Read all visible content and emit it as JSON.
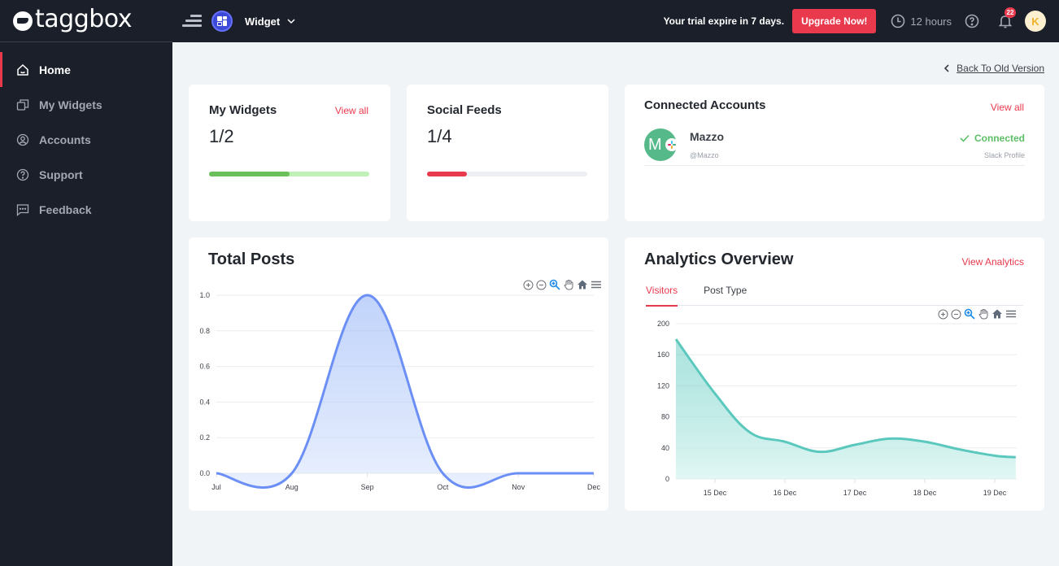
{
  "brand": {
    "name": "taggbox"
  },
  "sidebar": {
    "items": [
      {
        "label": "Home",
        "icon": "home-icon",
        "active": true
      },
      {
        "label": "My Widgets",
        "icon": "widgets-icon",
        "active": false
      },
      {
        "label": "Accounts",
        "icon": "user-circle-icon",
        "active": false
      },
      {
        "label": "Support",
        "icon": "question-circle-icon",
        "active": false
      },
      {
        "label": "Feedback",
        "icon": "chat-icon",
        "active": false
      }
    ]
  },
  "topbar": {
    "widget_label": "Widget",
    "trial_text": "Your trial expire in 7 days.",
    "upgrade_label": "Upgrade Now!",
    "hours_text": "12 hours",
    "notification_count": "22",
    "user_initial": "K"
  },
  "main": {
    "back_link": "Back To Old Version",
    "my_widgets": {
      "title": "My Widgets",
      "view_all": "View all",
      "value": "1/2",
      "progress": 0.5,
      "fill_color": "#6abf5a",
      "track_color": "#bff0b6"
    },
    "social_feeds": {
      "title": "Social Feeds",
      "value": "1/4",
      "progress": 0.25,
      "fill_color": "#e8394d",
      "track_color": "#eeeff4"
    },
    "connected_accounts": {
      "title": "Connected Accounts",
      "view_all": "View all",
      "accounts": [
        {
          "initial": "M",
          "name": "Mazzo",
          "handle": "@Mazzo",
          "status": "Connected",
          "type": "Slack Profile"
        }
      ]
    },
    "total_posts": {
      "title": "Total Posts"
    },
    "analytics": {
      "title": "Analytics Overview",
      "view_link": "View Analytics",
      "tabs": [
        {
          "label": "Visitors",
          "active": true
        },
        {
          "label": "Post Type",
          "active": false
        }
      ]
    }
  },
  "chart_data": [
    {
      "type": "area",
      "title": "Total Posts",
      "categories": [
        "Jul",
        "Aug",
        "Sep",
        "Oct",
        "Nov",
        "Dec"
      ],
      "series": [
        {
          "name": "Posts",
          "values": [
            0,
            0,
            1,
            0,
            0,
            0
          ]
        }
      ],
      "yticks": [
        "0.0",
        "0.2",
        "0.4",
        "0.6",
        "0.8",
        "1.0"
      ],
      "ylim": [
        0,
        1
      ],
      "grid": true,
      "color": "#6b8ff5"
    },
    {
      "type": "area",
      "title": "Visitors",
      "x": [
        "14 Dec (partial)",
        "15 Dec",
        "15.5 Dec",
        "16 Dec",
        "16.5 Dec",
        "17 Dec",
        "17.5 Dec",
        "18 Dec",
        "18.5 Dec",
        "19 Dec",
        "19.3 Dec"
      ],
      "xticks": [
        "15 Dec",
        "16 Dec",
        "17 Dec",
        "18 Dec",
        "19 Dec"
      ],
      "series": [
        {
          "name": "Visitors",
          "values": [
            180,
            110,
            60,
            48,
            35,
            44,
            52,
            48,
            38,
            30,
            28
          ]
        }
      ],
      "yticks": [
        "0",
        "40",
        "80",
        "120",
        "160",
        "200"
      ],
      "ylim": [
        0,
        200
      ],
      "grid": true,
      "color": "#5ac8bd"
    }
  ]
}
